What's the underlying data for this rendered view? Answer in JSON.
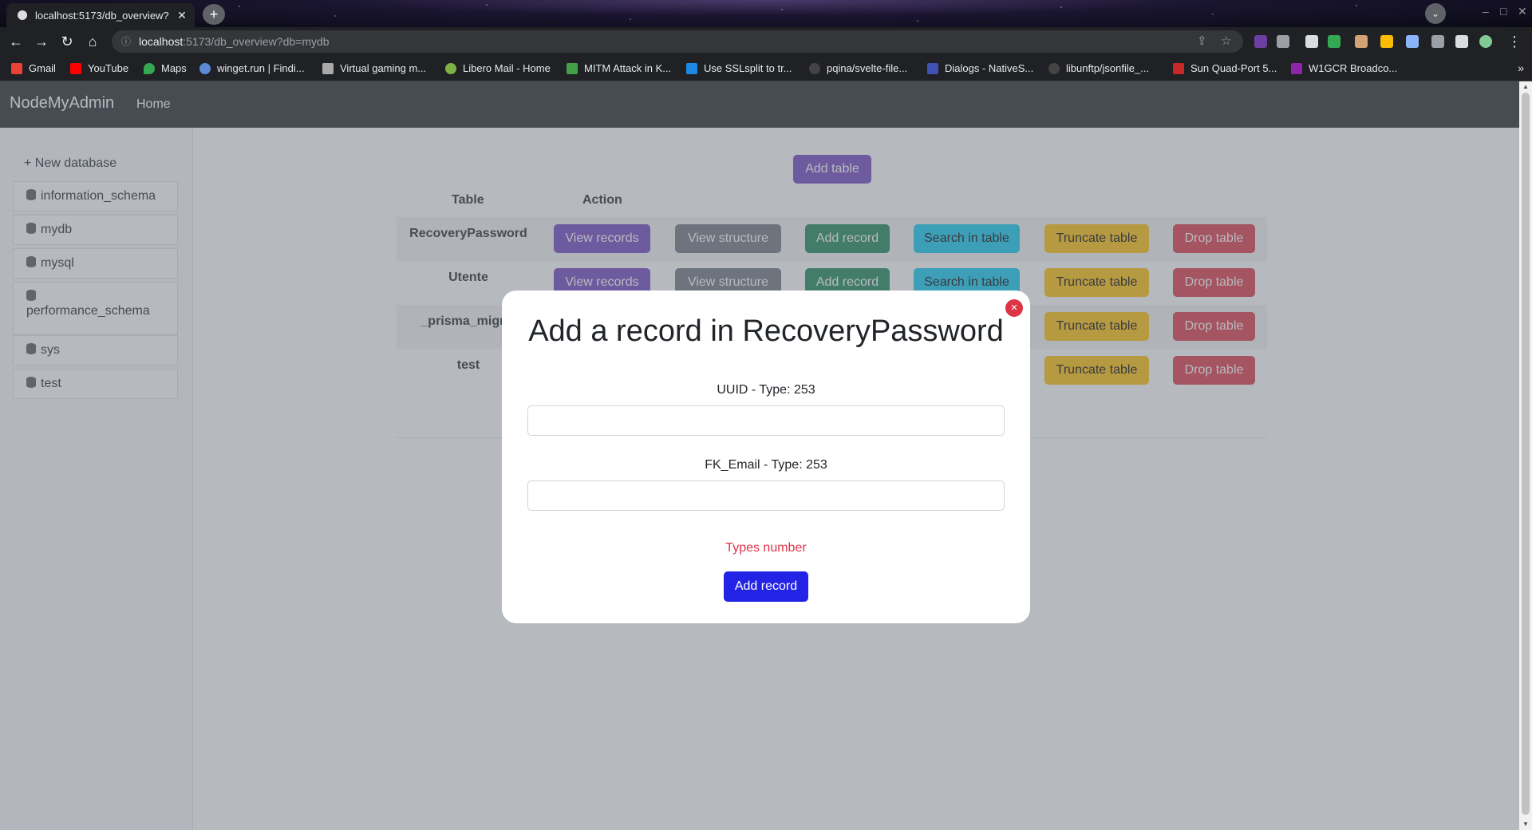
{
  "browser": {
    "tab_title": "localhost:5173/db_overview?",
    "tab_close": "✕",
    "new_tab": "+",
    "url_host": "localhost",
    "url_path": ":5173/db_overview?db=mydb",
    "bookmarks": [
      "Gmail",
      "YouTube",
      "Maps",
      "winget.run | Findi...",
      "Virtual gaming m...",
      "Libero Mail - Home",
      "MITM Attack in K...",
      "Use SSLsplit to tr...",
      "pqina/svelte-file...",
      "Dialogs - NativeS...",
      "libunftp/jsonfile_...",
      "Sun Quad-Port 5...",
      "W1GCR Broadco..."
    ],
    "bookmarks_more": "»"
  },
  "app": {
    "brand": "NodeMyAdmin",
    "nav_home": "Home"
  },
  "sidebar": {
    "new_database": "New database",
    "databases": [
      "information_schema",
      "mydb",
      "mysql",
      "performance_schema",
      "sys",
      "test"
    ]
  },
  "main": {
    "add_table": "Add table",
    "headers": {
      "table": "Table",
      "action": "Action"
    },
    "tables": [
      "RecoveryPassword",
      "Utente",
      "_prisma_migrat",
      "test"
    ],
    "buttons": {
      "view_records": "View records",
      "view_structure": "View structure",
      "add_record": "Add record",
      "search": "Search in table",
      "truncate": "Truncate table",
      "drop": "Drop table"
    }
  },
  "modal": {
    "close": "×",
    "title": "Add a record in RecoveryPassword",
    "fields": [
      {
        "label": "UUID - Type: 253",
        "value": ""
      },
      {
        "label": "FK_Email - Type: 253",
        "value": ""
      }
    ],
    "types_link": "Types number",
    "submit": "Add record"
  },
  "colors": {
    "primary": "#6f42c1",
    "secondary": "#6c757d",
    "success": "#198754",
    "info": "#0dcaf0",
    "warning": "#ffc107",
    "danger": "#dc3545",
    "submit": "#2323e6"
  }
}
